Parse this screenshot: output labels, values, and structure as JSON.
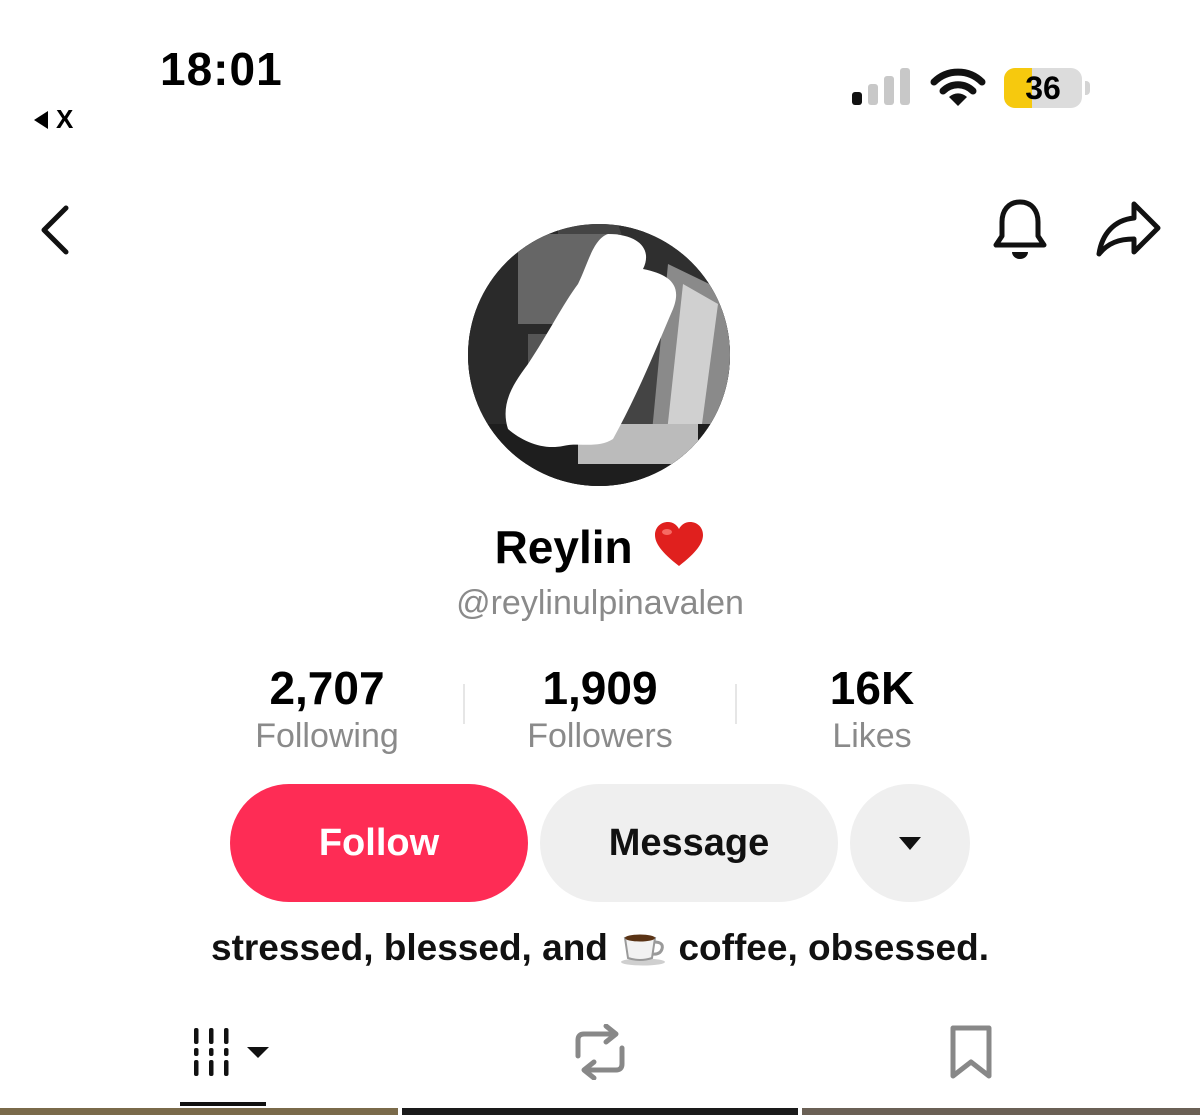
{
  "status_bar": {
    "time": "18:01",
    "back_app_label": "X",
    "battery_percent": "36",
    "battery_level": 0.36,
    "battery_color": "#f6c90e"
  },
  "profile": {
    "display_name": "Reylin",
    "name_emoji": "heart",
    "username": "@reylinulpinavalen",
    "stats": [
      {
        "value": "2,707",
        "label": "Following"
      },
      {
        "value": "1,909",
        "label": "Followers"
      },
      {
        "value": "16K",
        "label": "Likes"
      }
    ],
    "bio_before": "stressed, blessed, and",
    "bio_after": "coffee, obsessed."
  },
  "actions": {
    "follow_label": "Follow",
    "message_label": "Message",
    "follow_color": "#fe2c55"
  },
  "tabs": [
    "videos-grid-icon",
    "reposts-icon",
    "favorites-bookmark-icon"
  ],
  "icons": [
    "back-chevron-icon",
    "notification-bell-icon",
    "share-arrow-icon",
    "cellular-signal-icon",
    "wifi-icon",
    "battery-icon"
  ]
}
